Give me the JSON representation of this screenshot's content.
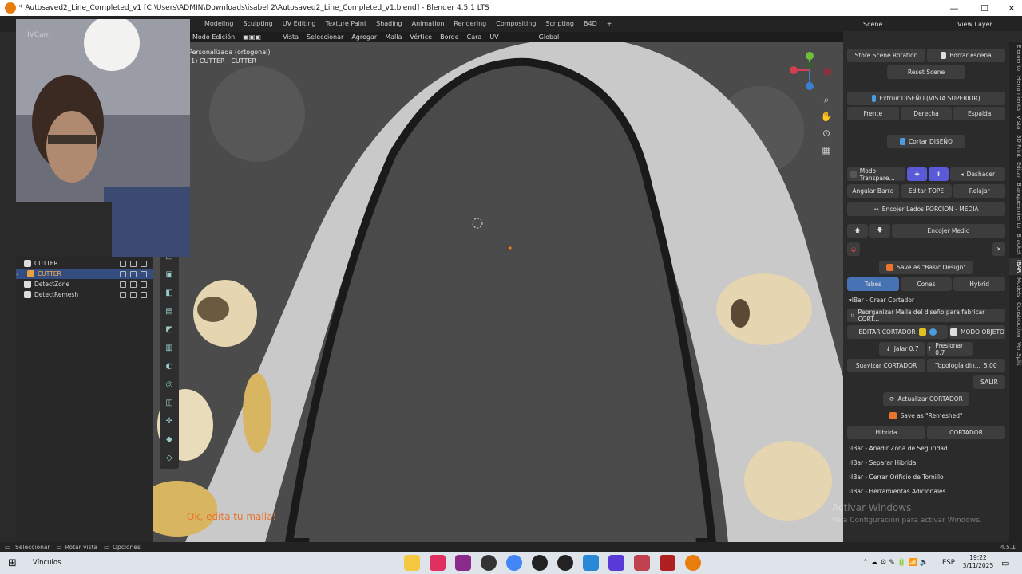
{
  "window": {
    "title": "* Autosaved2_Line_Completed_v1 [C:\\Users\\ADMIN\\Downloads\\isabel 2\\Autosaved2_Line_Completed_v1.blend] - Blender 4.5.1 LTS"
  },
  "workspaces": [
    "Modeling",
    "Sculpting",
    "UV Editing",
    "Texture Paint",
    "Shading",
    "Animation",
    "Rendering",
    "Compositing",
    "Scripting",
    "B4D"
  ],
  "scene": "Scene",
  "view_layer": "View Layer",
  "header": {
    "mode": "Modo Edición",
    "menus": [
      "Vista",
      "Seleccionar",
      "Agregar",
      "Malla",
      "Vértice",
      "Borde",
      "Cara",
      "UV"
    ],
    "orientation": "Global"
  },
  "viewport": {
    "view_name": "Personalizada (ortogonal)",
    "object_info": "(1) CUTTER | CUTTER",
    "subtitle": "Ok, edita tu malla!"
  },
  "outliner": {
    "items": [
      {
        "name": "CUTTER",
        "selected": false
      },
      {
        "name": "CUTTER",
        "selected": true
      },
      {
        "name": "DetectZone",
        "selected": false
      },
      {
        "name": "DetectRemesh",
        "selected": false
      }
    ]
  },
  "sidebar": {
    "store_rotation": "Store Scene Rotation",
    "borrar_escena": "Borrar escena",
    "reset_scene": "Reset Scene",
    "extruir": "Extruir DISEÑO (VISTA SUPERIOR)",
    "frente": "Frente",
    "derecha": "Derecha",
    "espalda": "Espalda",
    "cortar": "Cortar DISEÑO",
    "modo_transp": "Modo Transpare...",
    "deshacer": "Deshacer",
    "angular": "Angular Barra",
    "editar_tope": "Editar TOPE",
    "relajar": "Relajar",
    "encojer_lados": "Encojer Lados PORCION - MEDIA",
    "encojer_medio": "Encojer Medio",
    "save_basic": "Save as \"Basic Design\"",
    "tubes": "Tubes",
    "cones": "Cones",
    "hybrid": "Hybrid",
    "crear_cortador": "IBar - Crear Cortador",
    "reorganizar": "Reorganizar Malla del diseño para fabricar CORT...",
    "editar_cortador": "EDITAR CORTADOR",
    "modo_objeto": "MODO OBJETO",
    "jalar": "Jalar 0.7",
    "presionar": "Presionar 0.7",
    "suavizar": "Suavizar CORTADOR",
    "topologia": "Topología din...",
    "topologia_val": "5.00",
    "salir": "SALIR",
    "actualizar": "Actualizar CORTADOR",
    "save_remeshed": "Save as \"Remeshed\"",
    "hibrida": "Hibrida",
    "cortador": "CORTADOR",
    "sections": [
      "IBar - Añadir Zona de Seguridad",
      "IBar - Separar Hibrida",
      "IBar - Cerrar Orificio de Tornillo",
      "IBar - Herramientas Adicionales"
    ]
  },
  "tabs": [
    "Elemento",
    "Herramienta",
    "Vista",
    "3D Print",
    "Editar",
    "Blanqueamiento",
    "Bracket",
    "IBAR",
    "Models",
    "Construction",
    "VertSplit"
  ],
  "watermark": {
    "line1": "Activar Windows",
    "line2": "Ve a Configuración para activar Windows."
  },
  "statusbar": {
    "items": [
      "Seleccionar",
      "Rotar vista",
      "Opciones"
    ],
    "version": "4.5.1"
  },
  "taskbar": {
    "search": "Vínculos",
    "lang": "ESP",
    "time": "19:22",
    "date": "3/11/2025"
  },
  "colors": {
    "accent": "#4772b3",
    "subtitle": "#e8752b"
  }
}
